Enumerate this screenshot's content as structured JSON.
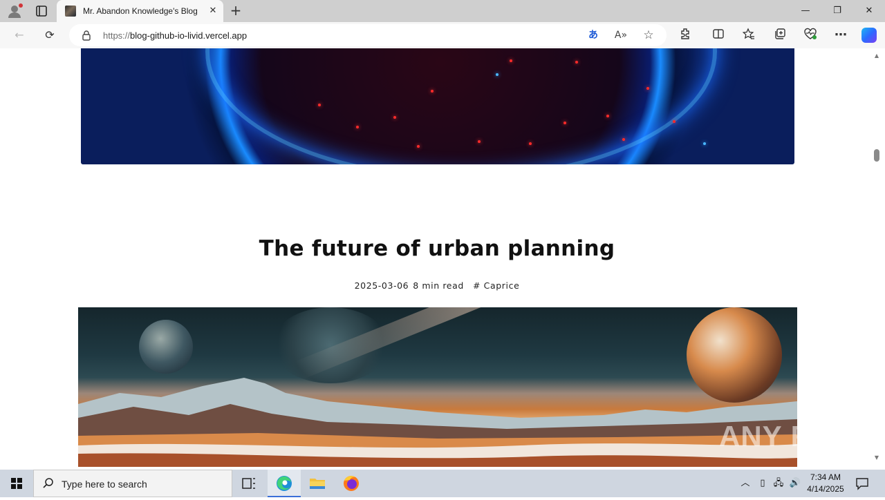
{
  "browser": {
    "tab_title": "Mr. Abandon Knowledge's Blog",
    "tab_close_glyph": "✕",
    "new_tab_glyph": "+",
    "url_scheme": "https://",
    "url_host": "blog-github-io-livid.vercel.app",
    "window_controls": {
      "minimize": "—",
      "restore": "❐",
      "close": "✕"
    },
    "nav": {
      "back": "←",
      "reload": "⟳"
    }
  },
  "page": {
    "post_title": "The future of urban planning",
    "post_date": "2025-03-06",
    "read_time": "8 min read",
    "tag": "# Caprice",
    "watermark": "ANY RUN"
  },
  "taskbar": {
    "search_placeholder": "Type here to search",
    "time": "7:34 AM",
    "date": "4/14/2025"
  },
  "icons": {
    "translate": "translate-icon",
    "read_aloud": "read-aloud-icon",
    "favorite": "star-icon",
    "extensions": "puzzle-icon",
    "split_screen": "split-screen-icon",
    "favorites_bar": "favorites-icon",
    "collections": "collections-icon",
    "browser_essentials": "heart-pulse-icon",
    "more": "ellipsis-icon",
    "copilot": "copilot-icon"
  },
  "colors": {
    "titlebar": "#cfcfcf",
    "toolbar": "#f7f7f7",
    "taskbar": "#cfd6e0",
    "accent": "#3a6fd8"
  }
}
